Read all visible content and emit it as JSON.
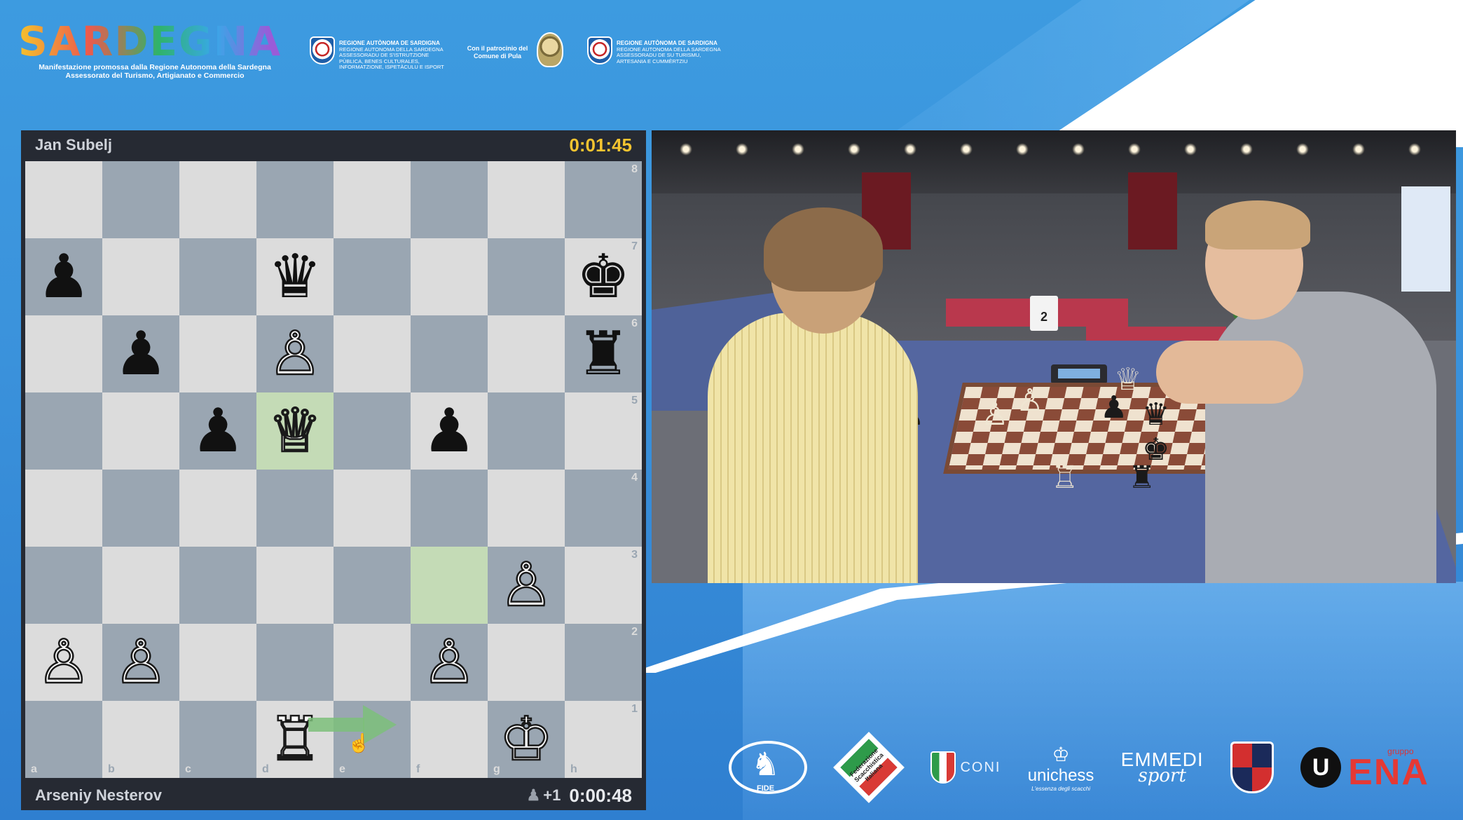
{
  "header": {
    "brand_title": "SARDEGNA",
    "brand_subtitle_1": "Manifestazione promossa dalla Regione Autonoma della Sardegna",
    "brand_subtitle_2": "Assessorato del Turismo, Artigianato e Commercio",
    "region_1_title": "REGIONE AUTÒNOMA DE SARDIGNA",
    "region_1_lines": "REGIONE AUTONOMA DELLA SARDEGNA ASSESSORADU DE S'ISTRUTZIONE PÙBLICA, BENES CULTURALES, INFORMATZIONE, ISPETÀCULU E ISPORT",
    "patron_line_1": "Con il patrocinio del",
    "patron_line_2": "Comune di Pula",
    "region_2_title": "REGIONE AUTÒNOMA DE SARDIGNA",
    "region_2_lines": "REGIONE AUTONOMA DELLA SARDEGNA ASSESSORADU DE SU TURISMU, ARTESANIA E CUMMÈRTZIU"
  },
  "game": {
    "top_player": "Jan Subelj",
    "top_clock": "0:01:45",
    "bottom_player": "Arseniy Nesterov",
    "bottom_clock": "0:00:48",
    "material_advantage": "+1",
    "highlight_squares": [
      "d5",
      "f3"
    ],
    "arrow": {
      "from": "d1",
      "to": "e1",
      "color": "#7dbf7a"
    },
    "files": [
      "a",
      "b",
      "c",
      "d",
      "e",
      "f",
      "g",
      "h"
    ],
    "ranks": [
      "8",
      "7",
      "6",
      "5",
      "4",
      "3",
      "2",
      "1"
    ],
    "pieces": {
      "a7": "bP",
      "d7": "bQ",
      "h7": "bK",
      "b6": "bP",
      "d6": "wP",
      "h6": "bR",
      "c5": "bP",
      "d5": "wQ",
      "f5": "bP",
      "g3": "wP",
      "a2": "wP",
      "b2": "wP",
      "f2": "wP",
      "d1": "wR",
      "g1": "wK"
    },
    "glyphs": {
      "wK": "♔",
      "wQ": "♕",
      "wR": "♖",
      "wP": "♙",
      "bK": "♚",
      "bQ": "♛",
      "bR": "♜",
      "bP": "♟"
    }
  },
  "video": {
    "board_number": "2"
  },
  "sponsors": {
    "fide": "FIDE",
    "fsi": "Federazione Scacchistica Italiana",
    "coni": "CONI",
    "unichess": "unichess",
    "unichess_sub": "L'essenza degli scacchi",
    "emmedi_main": "EMMEDI",
    "emmedi_sub": "sport",
    "ena_small": "gruppo",
    "ena_big": "ENA"
  }
}
